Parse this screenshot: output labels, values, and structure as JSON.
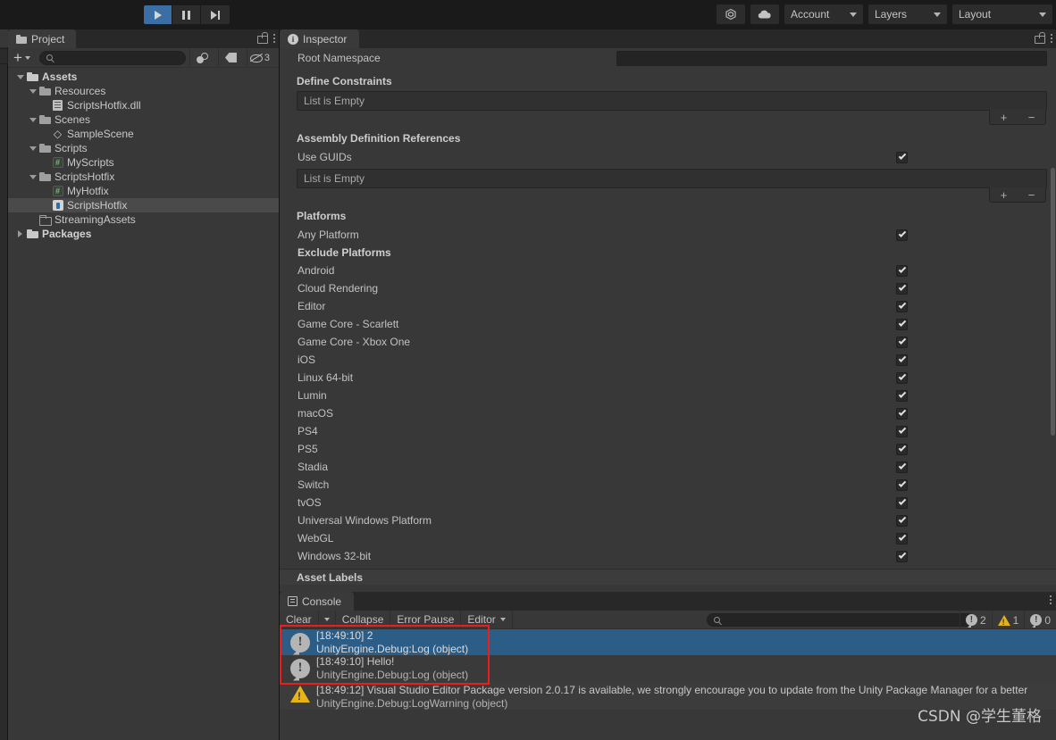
{
  "toolbar": {
    "play_icon": "play-icon",
    "pause_icon": "pause-icon",
    "step_icon": "step-icon",
    "collab_icon": "collab-icon",
    "cloud_icon": "cloud-icon",
    "account_label": "Account",
    "layers_label": "Layers",
    "layout_label": "Layout",
    "accent_blue": "#3a6ea5"
  },
  "project": {
    "tab_label": "Project",
    "search_placeholder": "",
    "search_value": "",
    "plus_label": "+",
    "hidden_count": "3",
    "tree": [
      {
        "label": "Assets",
        "depth": 0,
        "twisty": "down",
        "icon": "folder-solid-icon",
        "bold": true,
        "selected": false
      },
      {
        "label": "Resources",
        "depth": 1,
        "twisty": "down",
        "icon": "folder-icon",
        "bold": false,
        "selected": false
      },
      {
        "label": "ScriptsHotfix.dll",
        "depth": 2,
        "twisty": "none",
        "icon": "dll-icon",
        "bold": false,
        "selected": false
      },
      {
        "label": "Scenes",
        "depth": 1,
        "twisty": "down",
        "icon": "folder-icon",
        "bold": false,
        "selected": false
      },
      {
        "label": "SampleScene",
        "depth": 2,
        "twisty": "none",
        "icon": "unity-scene-icon",
        "bold": false,
        "selected": false
      },
      {
        "label": "Scripts",
        "depth": 1,
        "twisty": "down",
        "icon": "folder-icon",
        "bold": false,
        "selected": false
      },
      {
        "label": "MyScripts",
        "depth": 2,
        "twisty": "none",
        "icon": "csharp-script-icon",
        "bold": false,
        "selected": false
      },
      {
        "label": "ScriptsHotfix",
        "depth": 1,
        "twisty": "down",
        "icon": "folder-icon",
        "bold": false,
        "selected": false
      },
      {
        "label": "MyHotfix",
        "depth": 2,
        "twisty": "none",
        "icon": "csharp-script-icon",
        "bold": false,
        "selected": false
      },
      {
        "label": "ScriptsHotfix",
        "depth": 2,
        "twisty": "none",
        "icon": "assembly-definition-icon",
        "bold": false,
        "selected": true
      },
      {
        "label": "StreamingAssets",
        "depth": 1,
        "twisty": "none",
        "icon": "folder-outline-icon",
        "bold": false,
        "selected": false
      },
      {
        "label": "Packages",
        "depth": 0,
        "twisty": "right",
        "icon": "folder-solid-icon",
        "bold": true,
        "selected": false
      }
    ]
  },
  "inspector": {
    "tab_label": "Inspector",
    "root_namespace_label": "Root Namespace",
    "root_namespace_value": "",
    "define_constraints_title": "Define Constraints",
    "define_constraints_empty": "List is Empty",
    "assembly_refs_title": "Assembly Definition References",
    "use_guids_label": "Use GUIDs",
    "use_guids_checked": true,
    "assembly_refs_empty": "List is Empty",
    "add_label": "+",
    "remove_label": "−",
    "platforms_title": "Platforms",
    "any_platform_label": "Any Platform",
    "any_platform_checked": true,
    "exclude_platforms_label": "Exclude Platforms",
    "platforms": [
      {
        "label": "Android",
        "checked": true
      },
      {
        "label": "Cloud Rendering",
        "checked": true
      },
      {
        "label": "Editor",
        "checked": true
      },
      {
        "label": "Game Core - Scarlett",
        "checked": true
      },
      {
        "label": "Game Core - Xbox One",
        "checked": true
      },
      {
        "label": "iOS",
        "checked": true
      },
      {
        "label": "Linux 64-bit",
        "checked": true
      },
      {
        "label": "Lumin",
        "checked": true
      },
      {
        "label": "macOS",
        "checked": true
      },
      {
        "label": "PS4",
        "checked": true
      },
      {
        "label": "PS5",
        "checked": true
      },
      {
        "label": "Stadia",
        "checked": true
      },
      {
        "label": "Switch",
        "checked": true
      },
      {
        "label": "tvOS",
        "checked": true
      },
      {
        "label": "Universal Windows Platform",
        "checked": true
      },
      {
        "label": "WebGL",
        "checked": true
      },
      {
        "label": "Windows 32-bit",
        "checked": true
      }
    ],
    "asset_labels_title": "Asset Labels"
  },
  "console": {
    "tab_label": "Console",
    "clear_label": "Clear",
    "collapse_label": "Collapse",
    "error_pause_label": "Error Pause",
    "editor_label": "Editor",
    "search_placeholder": "",
    "search_value": "",
    "error_count": "2",
    "warning_count": "1",
    "info_count": "0",
    "entries": [
      {
        "type": "error",
        "line1": "[18:49:10] 2",
        "line2": "UnityEngine.Debug:Log (object)",
        "selected": true
      },
      {
        "type": "error",
        "line1": "[18:49:10] Hello!",
        "line2": "UnityEngine.Debug:Log (object)",
        "selected": false
      },
      {
        "type": "warning",
        "line1": "[18:49:12] Visual Studio Editor Package version 2.0.17 is available, we strongly encourage you to update from the Unity Package Manager for a better",
        "line2": "UnityEngine.Debug:LogWarning (object)",
        "selected": false
      }
    ],
    "highlight_color": "#ee1c1c"
  },
  "watermark": {
    "text": "CSDN @学生董格"
  }
}
